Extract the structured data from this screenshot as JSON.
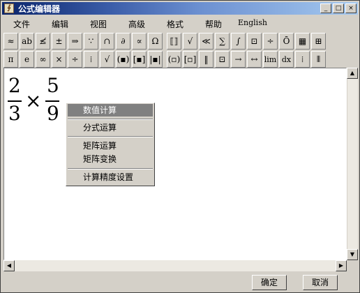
{
  "window": {
    "title": "公式编辑器"
  },
  "title_buttons": {
    "minimize": "_",
    "maximize": "□",
    "close": "×"
  },
  "menu": {
    "items": [
      "文件",
      "编辑",
      "视图",
      "高级",
      "格式",
      "帮助",
      "English"
    ]
  },
  "toolbar1": [
    "≈",
    "ab",
    "≰",
    "±",
    "⇒",
    "∵",
    "∩",
    "∂",
    "∝",
    "Ω",
    "⟦⟧",
    "√",
    "≪",
    "∑",
    "∫",
    "⊡",
    "÷",
    "Ō",
    "▦",
    "⊞"
  ],
  "toolbar2": [
    "π",
    "e",
    "∞",
    "×",
    "÷",
    "⁞",
    "√",
    "(▪)",
    "[▪]",
    "|▪|",
    "(▫)",
    "[▫]",
    "‖",
    "⊡",
    "→",
    "↔",
    "lim",
    "dx",
    "⁞",
    "⦀"
  ],
  "equation": {
    "num1": "2",
    "den1": "3",
    "op": "×",
    "num2": "5",
    "den2": "9"
  },
  "context_menu": {
    "items": [
      "数值计算",
      "分式运算",
      "矩阵运算",
      "矩阵变换",
      "计算精度设置"
    ]
  },
  "buttons": {
    "ok": "确定",
    "cancel": "取消"
  },
  "colors": {
    "title_start": "#0a246a",
    "title_end": "#a6caf0",
    "highlight": "#808080"
  }
}
